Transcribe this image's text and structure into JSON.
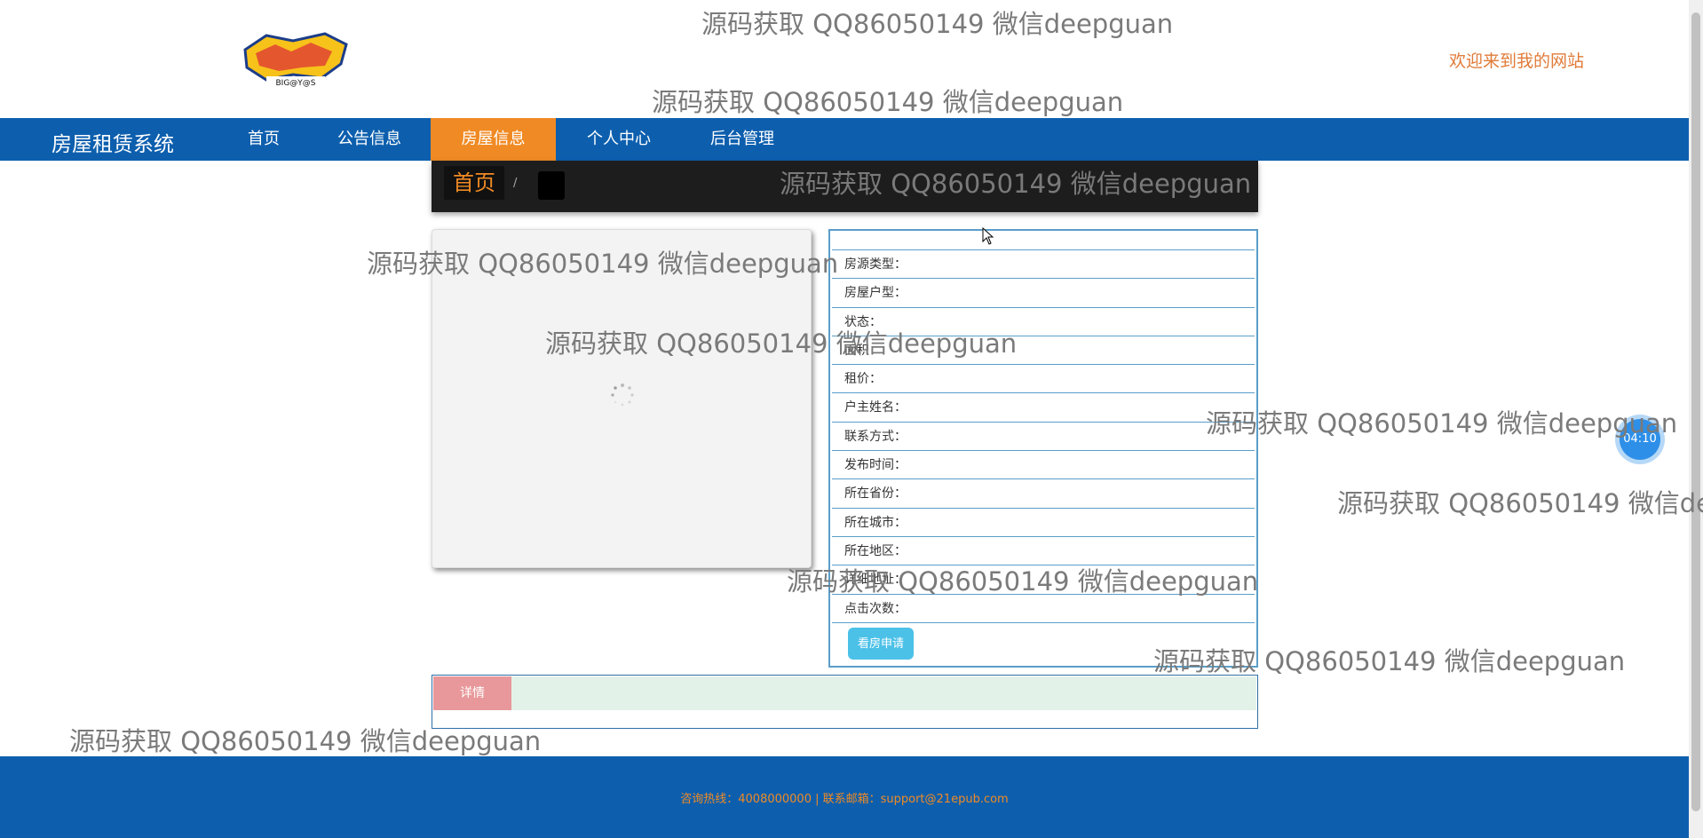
{
  "header": {
    "welcome": "欢迎来到我的网站",
    "logo_text": "BIG@Y@S"
  },
  "nav": {
    "brand": "房屋租赁系统",
    "items": [
      {
        "label": "首页",
        "active": false
      },
      {
        "label": "公告信息",
        "active": false
      },
      {
        "label": "房屋信息",
        "active": true
      },
      {
        "label": "个人中心",
        "active": false
      },
      {
        "label": "后台管理",
        "active": false
      }
    ]
  },
  "breadcrumb": {
    "home": "首页",
    "separator": "/"
  },
  "info": {
    "rows": [
      "房源类型：",
      "房屋户型：",
      "状态：",
      "面积：",
      "租价：",
      "户主姓名：",
      "联系方式：",
      "发布时间：",
      "所在省份：",
      "所在城市：",
      "所在地区：",
      "详细地址：",
      "点击次数："
    ],
    "apply_button": "看房申请"
  },
  "detail": {
    "tab_label": "详情"
  },
  "footer": {
    "text": "咨询热线：4008000000 | 联系邮箱：support@21epub.com"
  },
  "timer": {
    "value": "04:10"
  },
  "watermark": {
    "text": "源码获取 QQ86050149 微信deepguan"
  },
  "colors": {
    "nav_bg": "#0d5fae",
    "accent": "#f08a24",
    "table_border": "#5a9ec9",
    "apply_button": "#4cc1e8",
    "detail_tab": "#e8989a"
  }
}
